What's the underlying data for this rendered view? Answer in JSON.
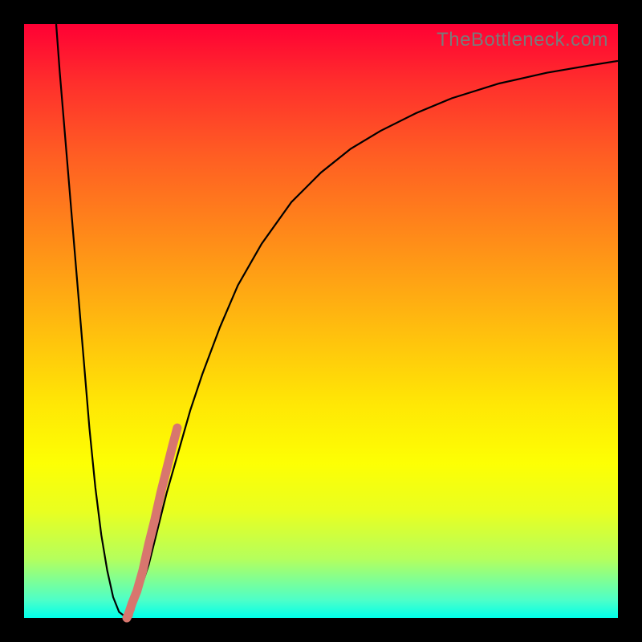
{
  "watermark": "TheBottleneck.com",
  "colors": {
    "frame": "#000000",
    "curve": "#000000",
    "marker": "#d8766e",
    "watermark": "#7a7a7a"
  },
  "chart_data": {
    "type": "line",
    "title": "",
    "xlabel": "",
    "ylabel": "",
    "xlim": [
      0,
      100
    ],
    "ylim": [
      0,
      100
    ],
    "grid": false,
    "legend": false,
    "series": [
      {
        "name": "bottleneck-curve",
        "x": [
          5.4,
          6,
          7,
          8,
          9,
          10,
          11,
          12,
          13,
          14,
          15,
          16,
          17.3,
          18,
          19,
          20,
          21,
          22,
          24,
          26,
          28,
          30,
          33,
          36,
          40,
          45,
          50,
          55,
          60,
          66,
          72,
          80,
          88,
          95,
          100
        ],
        "y": [
          100,
          92,
          80,
          68,
          56,
          44,
          32,
          22,
          14,
          8,
          3.5,
          1,
          0,
          1,
          3,
          6,
          9,
          13,
          21,
          28,
          35,
          41,
          49,
          56,
          63,
          70,
          75,
          79,
          82,
          85,
          87.5,
          90,
          91.8,
          93,
          93.8
        ]
      }
    ],
    "highlighted_segment": {
      "name": "marked-range",
      "x": [
        17.3,
        17.7,
        18.2,
        19.0,
        20.0,
        21.0,
        22.0,
        23.0,
        24.0,
        25.0,
        25.8
      ],
      "y": [
        0,
        1.0,
        2.5,
        4.5,
        8.0,
        12.5,
        16.5,
        21.0,
        25.0,
        29.0,
        32.0
      ]
    }
  }
}
